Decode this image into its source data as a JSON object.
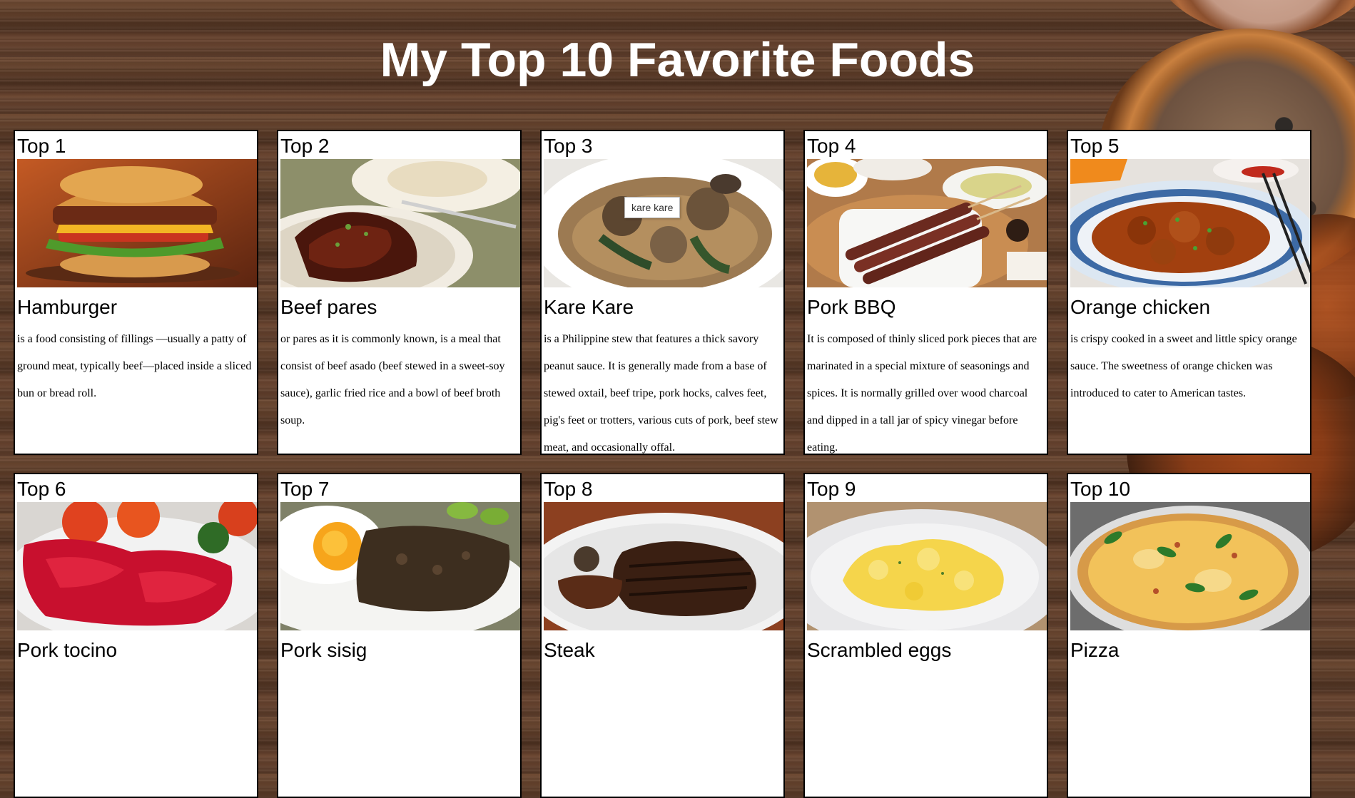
{
  "page": {
    "title": "My Top 10 Favorite Foods",
    "tooltip": "kare kare"
  },
  "foods": [
    {
      "rank": "Top 1",
      "name": "Hamburger",
      "description": "is a food consisting of fillings —usually a patty of ground meat, typically beef—placed inside a sliced bun or bread roll.",
      "image_alt": "hamburger"
    },
    {
      "rank": "Top 2",
      "name": "Beef pares",
      "description": "or pares as it is commonly known, is a meal that consist of beef asado (beef stewed in a sweet-soy sauce), garlic fried rice and a bowl of beef broth soup.",
      "image_alt": "beef pares"
    },
    {
      "rank": "Top 3",
      "name": "Kare Kare",
      "description": "is a Philippine stew that features a thick savory peanut sauce. It is generally made from a base of stewed oxtail, beef tripe, pork hocks, calves feet, pig's feet or trotters, various cuts of pork, beef stew meat, and occasionally offal.",
      "image_alt": "kare kare"
    },
    {
      "rank": "Top 4",
      "name": "Pork BBQ",
      "description": "It is composed of thinly sliced pork pieces that are marinated in a special mixture of seasonings and spices. It is normally grilled over wood charcoal and dipped in a tall jar of spicy vinegar before eating.",
      "image_alt": "pork bbq"
    },
    {
      "rank": "Top 5",
      "name": "Orange chicken",
      "description": "is crispy cooked in a sweet and little spicy orange sauce. The sweetness of orange chicken was introduced to cater to American tastes.",
      "image_alt": "orange chicken"
    },
    {
      "rank": "Top 6",
      "name": "Pork tocino",
      "description": "",
      "image_alt": "pork tocino"
    },
    {
      "rank": "Top 7",
      "name": "Pork sisig",
      "description": "",
      "image_alt": "pork sisig"
    },
    {
      "rank": "Top 8",
      "name": "Steak",
      "description": "",
      "image_alt": "steak"
    },
    {
      "rank": "Top 9",
      "name": "Scrambled eggs",
      "description": "",
      "image_alt": "scrambled eggs"
    },
    {
      "rank": "Top 10",
      "name": "Pizza",
      "description": "",
      "image_alt": "pizza"
    }
  ],
  "colors": {
    "title": "#ffffff",
    "card_bg": "#ffffff",
    "card_border": "#000000",
    "wood": "#5a3a26"
  }
}
